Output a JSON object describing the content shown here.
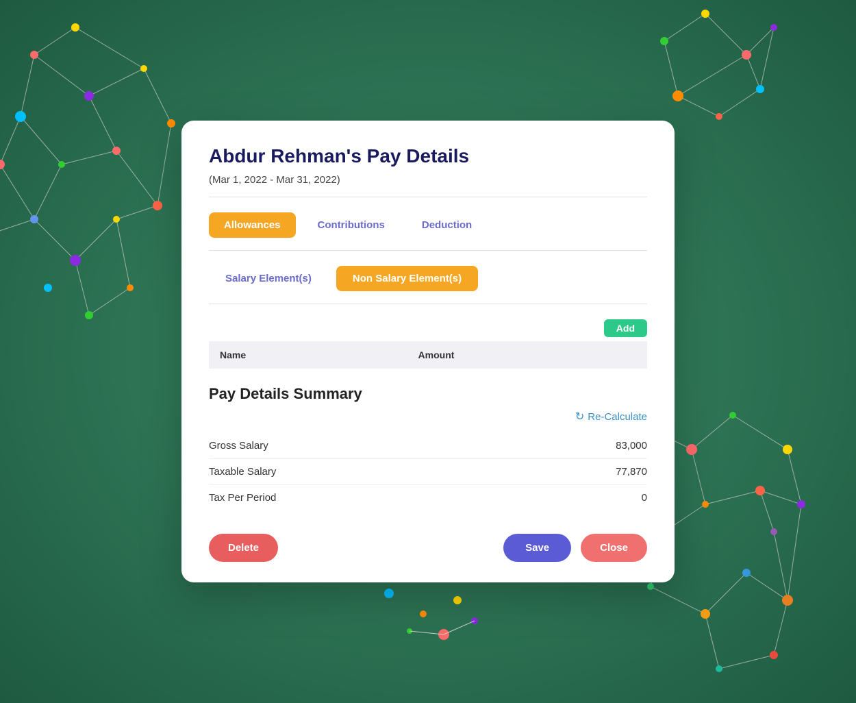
{
  "background": {
    "color": "#3a8a65"
  },
  "modal": {
    "title": "Abdur Rehman's Pay Details",
    "date_range": "(Mar 1, 2022 - Mar 31, 2022)",
    "tabs": [
      {
        "id": "allowances",
        "label": "Allowances",
        "active": true
      },
      {
        "id": "contributions",
        "label": "Contributions",
        "active": false
      },
      {
        "id": "deduction",
        "label": "Deduction",
        "active": false
      }
    ],
    "sub_tabs": [
      {
        "id": "salary",
        "label": "Salary Element(s)",
        "active": false
      },
      {
        "id": "non-salary",
        "label": "Non Salary Element(s)",
        "active": true
      }
    ],
    "add_button_label": "Add",
    "table": {
      "columns": [
        "Name",
        "Amount"
      ],
      "rows": []
    },
    "summary": {
      "title": "Pay Details Summary",
      "recalculate_label": "Re-Calculate",
      "rows": [
        {
          "label": "Gross Salary",
          "amount": "83,000"
        },
        {
          "label": "Taxable Salary",
          "amount": "77,870"
        },
        {
          "label": "Tax Per Period",
          "amount": "0"
        }
      ]
    },
    "footer": {
      "delete_label": "Delete",
      "save_label": "Save",
      "close_label": "Close"
    }
  }
}
